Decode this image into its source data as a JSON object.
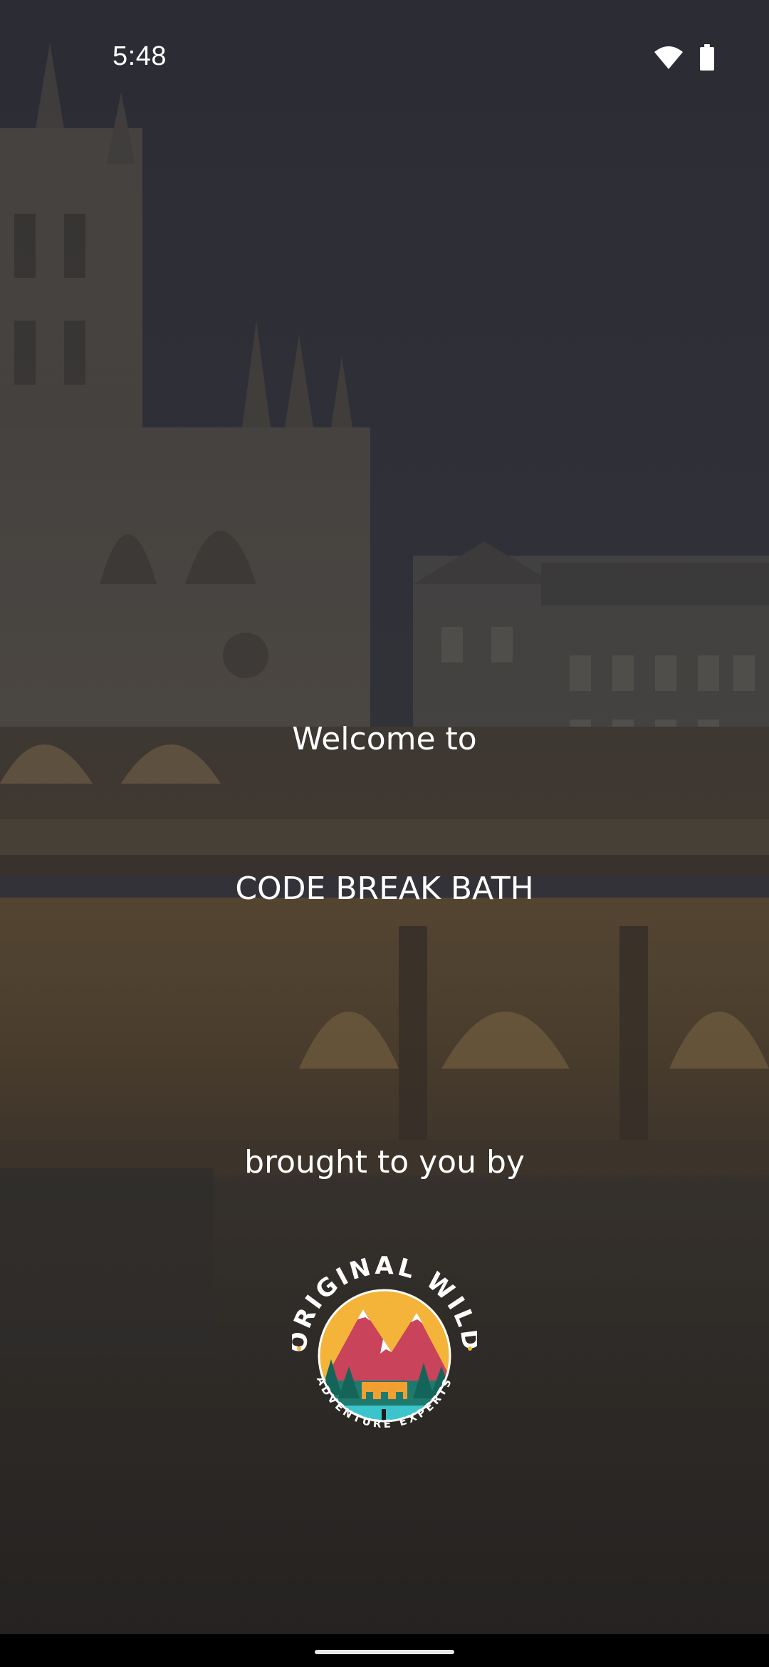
{
  "status_bar": {
    "time": "5:48",
    "icons": [
      "wifi-icon",
      "battery-icon"
    ]
  },
  "splash": {
    "welcome_text": "Welcome to",
    "app_name": "CODE BREAK BATH",
    "brought_by_text": "brought to you by"
  },
  "logo": {
    "top_text": "ORIGINAL WILD",
    "bottom_text": "ADVENTURE EXPERTS",
    "colors": {
      "sun": "#f4b43a",
      "mountains": "#c9435a",
      "forest": "#1f7a6e",
      "water": "#3cc4cc",
      "bridge": "#f0a030"
    }
  },
  "theme": {
    "overlay": "#2a2a30",
    "text": "#ffffff"
  }
}
